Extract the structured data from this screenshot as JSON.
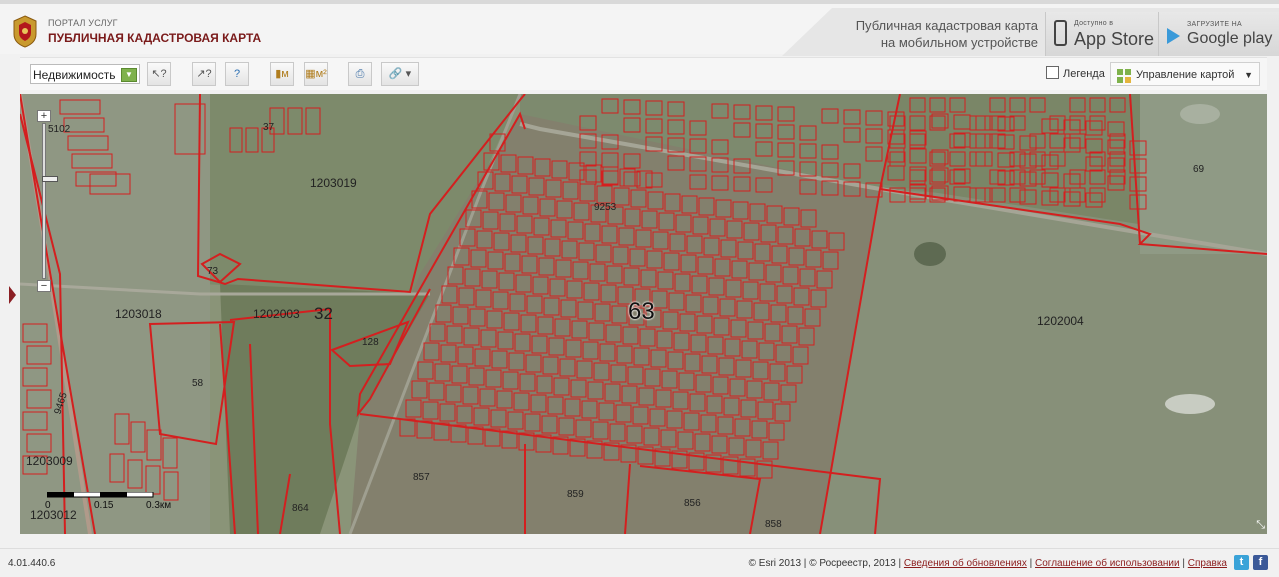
{
  "header": {
    "portal_small": "ПОРТАЛ УСЛУГ",
    "portal_title": "ПУБЛИЧНАЯ КАДАСТРОВАЯ КАРТА",
    "promo_line1": "Публичная кадастровая карта",
    "promo_line2": "на мобильном устройстве",
    "appstore_small": "Доступно в",
    "appstore_big": "App Store",
    "googleplay_small": "ЗАГРУЗИТЕ НА",
    "googleplay_big": "Google play"
  },
  "toolbar": {
    "layer_select": "Недвижимость",
    "legend_label": "Легенда",
    "map_control_label": "Управление картой"
  },
  "map": {
    "labels": {
      "q5102": "5102",
      "q37": "37",
      "q1203019": "1203019",
      "q73": "73",
      "q1203018": "1203018",
      "q1202003": "1202003",
      "q32": "32",
      "q128": "128",
      "q9253": "9253",
      "q63": "63",
      "q69": "69",
      "q1202004": "1202004",
      "q58": "58",
      "q9465": "9465",
      "q1203009": "1203009",
      "q857": "857",
      "q859": "859",
      "q856": "856",
      "q864": "864",
      "q858": "858",
      "q1203012": "1203012"
    },
    "scale": {
      "s0": "0",
      "s1": "0.15",
      "s2": "0.3км"
    },
    "zoom_in": "+",
    "zoom_out": "−",
    "boundary_color": "#d41f1f",
    "field_color": "#7f8b72"
  },
  "footer": {
    "version": "4.01.440.6",
    "copyright": "© Esri 2013 | © Росреестр, 2013 |",
    "link_updates": "Сведения об обновлениях",
    "sep1": "|",
    "link_terms": "Соглашение об использовании",
    "sep2": "|",
    "link_help": "Справка"
  }
}
